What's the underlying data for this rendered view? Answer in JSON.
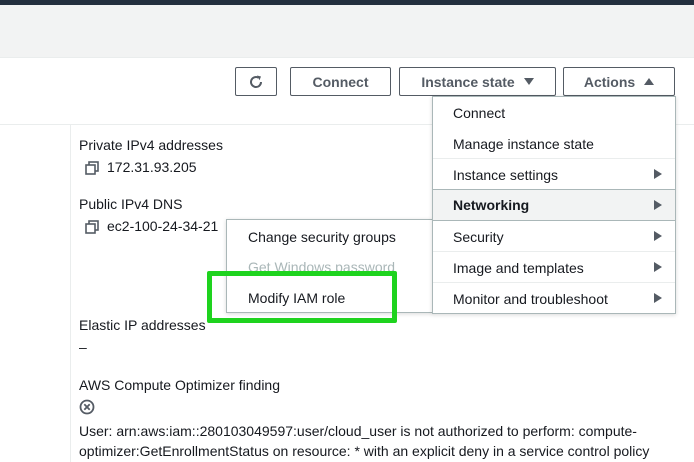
{
  "header": {
    "refresh_icon": "refresh-icon",
    "connect_label": "Connect",
    "instance_state_label": "Instance state",
    "actions_label": "Actions"
  },
  "details": {
    "private_ipv4": {
      "label": "Private IPv4 addresses",
      "value": "172.31.93.205"
    },
    "public_dns": {
      "label": "Public IPv4 DNS",
      "value": "ec2-100-24-34-21"
    },
    "elastic_ip": {
      "label": "Elastic IP addresses",
      "value": "–"
    },
    "optimizer": {
      "label": "AWS Compute Optimizer finding",
      "message": "User: arn:aws:iam::280103049597:user/cloud_user is not authorized to perform: compute-optimizer:GetEnrollmentStatus on resource: * with an explicit deny in a service control policy"
    }
  },
  "actions_menu": {
    "items": [
      {
        "label": "Connect",
        "submenu": false
      },
      {
        "label": "Manage instance state",
        "submenu": false
      },
      {
        "label": "Instance settings",
        "submenu": true
      },
      {
        "label": "Networking",
        "submenu": true,
        "highlighted": true
      },
      {
        "label": "Security",
        "submenu": true
      },
      {
        "label": "Image and templates",
        "submenu": true
      },
      {
        "label": "Monitor and troubleshoot",
        "submenu": true
      }
    ]
  },
  "networking_submenu": {
    "items": [
      {
        "label": "Change security groups",
        "disabled": false
      },
      {
        "label": "Get Windows password",
        "disabled": true
      },
      {
        "label": "Modify IAM role",
        "disabled": false
      }
    ]
  },
  "colors": {
    "highlight_box": "#1ed31e",
    "menu_border": "#aab7b8",
    "button_text": "#545b64"
  }
}
